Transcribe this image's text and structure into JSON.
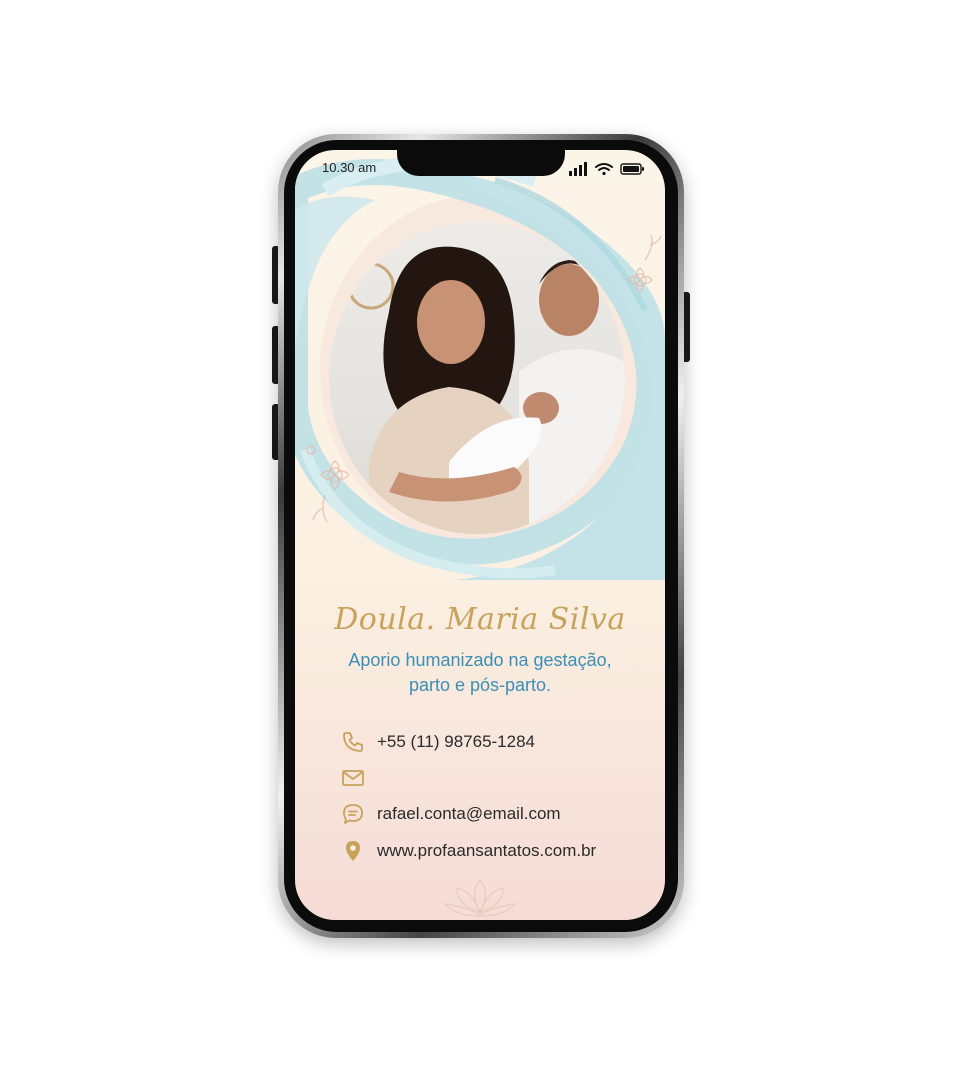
{
  "status_bar": {
    "time": "10.30 am"
  },
  "card": {
    "name": "Doula. Maria Silva",
    "tagline_line1": "Aporio humanizado na gestação,",
    "tagline_line2": "parto e pós-parto."
  },
  "contacts": {
    "phone": "+55 (11) 98765-1284",
    "email_label": "",
    "chat": "rafael.conta@email.com",
    "website": "www.profaansantatos.com.br"
  },
  "icons": [
    "phone-icon",
    "envelope-icon",
    "chat-bubble-icon",
    "location-pin-icon",
    "signal-icon",
    "wifi-icon",
    "battery-icon",
    "lotus-icon",
    "floral-decoration-icon"
  ],
  "colors": {
    "accent_gold": "#c7a25a",
    "accent_blue": "#3b8fb5",
    "swirl_blue": "#bfe0e6",
    "background_cream": "#fbf5e8",
    "background_pink": "#f5dcd6"
  }
}
